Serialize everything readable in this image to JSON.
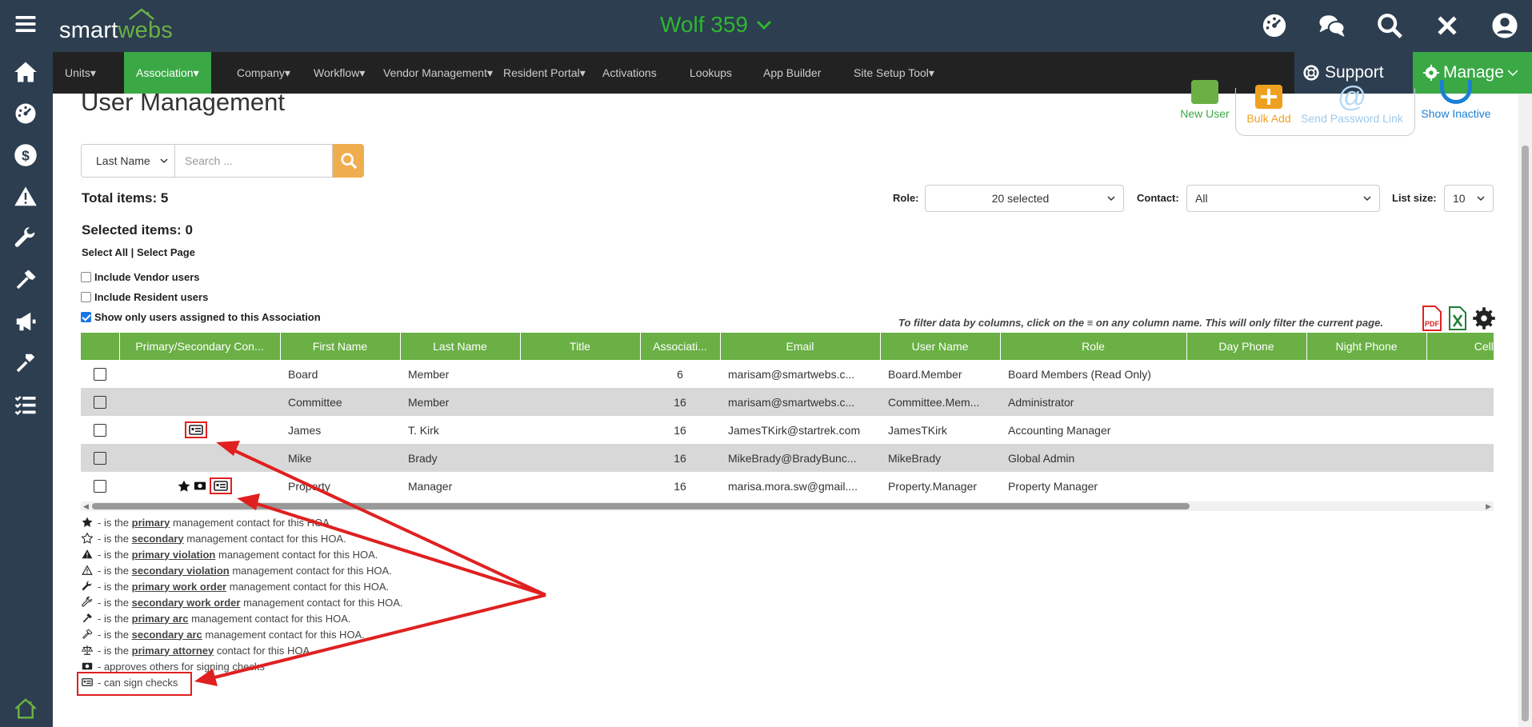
{
  "app": {
    "logo_left": "smart",
    "logo_right": "webs",
    "association_name": "Wolf 359",
    "logo_house_icon": "house-logo-icon"
  },
  "top_icons": [
    "dashboard-icon",
    "chat-icon",
    "search-icon",
    "close-icon",
    "user-icon"
  ],
  "rail_icons": [
    "menu-icon",
    "home-icon",
    "dashboard-icon",
    "dollar-icon",
    "warning-icon",
    "wrench-icon",
    "hammer-icon",
    "megaphone-icon",
    "tools-icon",
    "checklist-icon"
  ],
  "menu": {
    "items": [
      "Units",
      "Association",
      "Company",
      "Workflow",
      "Vendor Management",
      "Resident Portal",
      "Activations",
      "Lookups",
      "App Builder",
      "Site Setup Tool"
    ],
    "active": "Association",
    "support": "Support",
    "manage": "Manage"
  },
  "page": {
    "title": "User Management",
    "buttons": {
      "new_user": "New User",
      "bulk_add": "Bulk Add",
      "send_password": "Send Password Link",
      "show_inactive": "Show Inactive"
    },
    "search": {
      "field": "Last Name",
      "placeholder": "Search ..."
    },
    "total_items": "Total items: 5",
    "selected_items": "Selected items: 0",
    "select_all": "Select All",
    "select_sep": "|",
    "select_page": "Select Page",
    "checkboxes": [
      {
        "label": "Include Vendor users",
        "checked": false
      },
      {
        "label": "Include Resident users",
        "checked": false
      },
      {
        "label": "Show only users assigned to this Association",
        "checked": true
      }
    ],
    "filters": {
      "role_label": "Role:",
      "role_value": "20 selected",
      "contact_label": "Contact:",
      "contact_value": "All",
      "list_size_label": "List size:",
      "list_size_value": "10"
    },
    "filter_note": "To filter data by columns, click on the ≡ on any column name. This will only filter the current page."
  },
  "table": {
    "columns": [
      "",
      "Primary/Secondary Con...",
      "First Name",
      "Last Name",
      "Title",
      "Associati...",
      "Email",
      "User Name",
      "Role",
      "Day Phone",
      "Night Phone",
      "Cell Phone"
    ],
    "rows": [
      {
        "first": "Board",
        "last": "Member",
        "title": "",
        "assoc": "6",
        "email": "marisam@smartwebs.c...",
        "user": "Board.Member",
        "role": "Board Members (Read Only)"
      },
      {
        "first": "Committee",
        "last": "Member",
        "title": "",
        "assoc": "16",
        "email": "marisam@smartwebs.c...",
        "user": "Committee.Mem...",
        "role": "Administrator"
      },
      {
        "first": "James",
        "last": "T. Kirk",
        "title": "",
        "assoc": "16",
        "email": "JamesTKirk@startrek.com",
        "user": "JamesTKirk",
        "role": "Accounting Manager"
      },
      {
        "first": "Mike",
        "last": "Brady",
        "title": "",
        "assoc": "16",
        "email": "MikeBrady@BradyBunc...",
        "user": "MikeBrady",
        "role": "Global Admin"
      },
      {
        "first": "Property",
        "last": "Manager",
        "title": "",
        "assoc": "16",
        "email": "marisa.mora.sw@gmail....",
        "user": "Property.Manager",
        "role": "Property Manager"
      }
    ]
  },
  "legend": [
    {
      "icon": "star-solid-icon",
      "pre": " - is the ",
      "key": "primary",
      "post": " management contact for this HOA."
    },
    {
      "icon": "star-outline-icon",
      "pre": " - is the ",
      "key": "secondary",
      "post": " management contact for this HOA."
    },
    {
      "icon": "warning-solid-icon",
      "pre": " - is the ",
      "key": "primary violation",
      "post": " management contact for this HOA."
    },
    {
      "icon": "warning-outline-icon",
      "pre": " - is the ",
      "key": "secondary violation",
      "post": " management contact for this HOA."
    },
    {
      "icon": "wrench-solid-icon",
      "pre": " - is the ",
      "key": "primary work order",
      "post": " management contact for this HOA."
    },
    {
      "icon": "wrench-outline-icon",
      "pre": " - is the ",
      "key": "secondary work order",
      "post": " management contact for this HOA."
    },
    {
      "icon": "hammer-solid-icon",
      "pre": " - is the ",
      "key": "primary arc",
      "post": " management contact for this HOA."
    },
    {
      "icon": "hammer-outline-icon",
      "pre": " - is the ",
      "key": "secondary arc",
      "post": " management contact for this HOA."
    },
    {
      "icon": "scale-icon",
      "pre": " - is the ",
      "key": "primary attorney",
      "post": " contact for this HOA."
    },
    {
      "icon": "money-icon",
      "pre": " - approves others for signing checks",
      "key": "",
      "post": ""
    },
    {
      "icon": "id-card-icon",
      "pre": " - can sign checks",
      "key": "",
      "post": ""
    }
  ],
  "colors": {
    "nav_bg": "#2c3e50",
    "menu_bg": "#222222",
    "accent_green": "#3aa845",
    "header_green": "#6ab045",
    "title_green": "#2eb82e",
    "annotation_red": "#e02020"
  }
}
